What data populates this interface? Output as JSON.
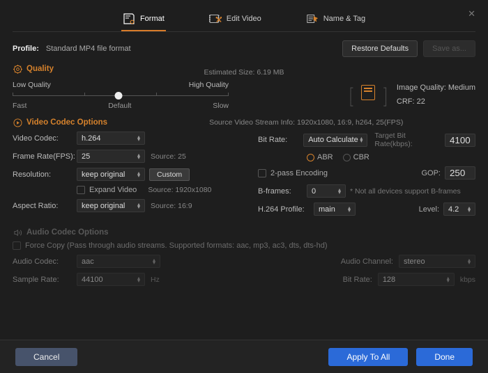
{
  "tabs": {
    "format": "Format",
    "edit": "Edit Video",
    "name": "Name & Tag"
  },
  "profile": {
    "label": "Profile:",
    "value": "Standard MP4 file format"
  },
  "buttons": {
    "restore": "Restore Defaults",
    "saveas": "Save as...",
    "cancel": "Cancel",
    "apply": "Apply To All",
    "done": "Done",
    "custom": "Custom"
  },
  "quality": {
    "title": "Quality",
    "est": "Estimated Size: 6.19 MB",
    "low": "Low Quality",
    "high": "High Quality",
    "fast": "Fast",
    "default": "Default",
    "slow": "Slow",
    "iq_label": "Image Quality: Medium",
    "crf": "CRF: 22"
  },
  "video": {
    "title": "Video Codec Options",
    "sinfo": "Source Video Stream Info: 1920x1080, 16:9, h264, 25(FPS)",
    "codec_l": "Video Codec:",
    "codec_v": "h.264",
    "fps_l": "Frame Rate(FPS):",
    "fps_v": "25",
    "fps_src": "Source: 25",
    "res_l": "Resolution:",
    "res_v": "keep original",
    "expand": "Expand Video",
    "res_src": "Source: 1920x1080",
    "ar_l": "Aspect Ratio:",
    "ar_v": "keep original",
    "ar_src": "Source: 16:9",
    "br_l": "Bit Rate:",
    "br_v": "Auto Calculate",
    "tbr_l": "Target Bit Rate(kbps):",
    "tbr_v": "4100",
    "abr": "ABR",
    "cbr": "CBR",
    "pass2": "2-pass Encoding",
    "gop_l": "GOP:",
    "gop_v": "250",
    "bfr_l": "B-frames:",
    "bfr_v": "0",
    "bfr_note": "* Not all devices support B-frames",
    "prof_l": "H.264 Profile:",
    "prof_v": "main",
    "lvl_l": "Level:",
    "lvl_v": "4.2"
  },
  "audio": {
    "title": "Audio Codec Options",
    "force": "Force Copy (Pass through audio streams. Supported formats: aac, mp3, ac3, dts, dts-hd)",
    "codec_l": "Audio Codec:",
    "codec_v": "aac",
    "ch_l": "Audio Channel:",
    "ch_v": "stereo",
    "sr_l": "Sample Rate:",
    "sr_v": "44100",
    "sr_u": "Hz",
    "br_l": "Bit Rate:",
    "br_v": "128",
    "br_u": "kbps"
  }
}
